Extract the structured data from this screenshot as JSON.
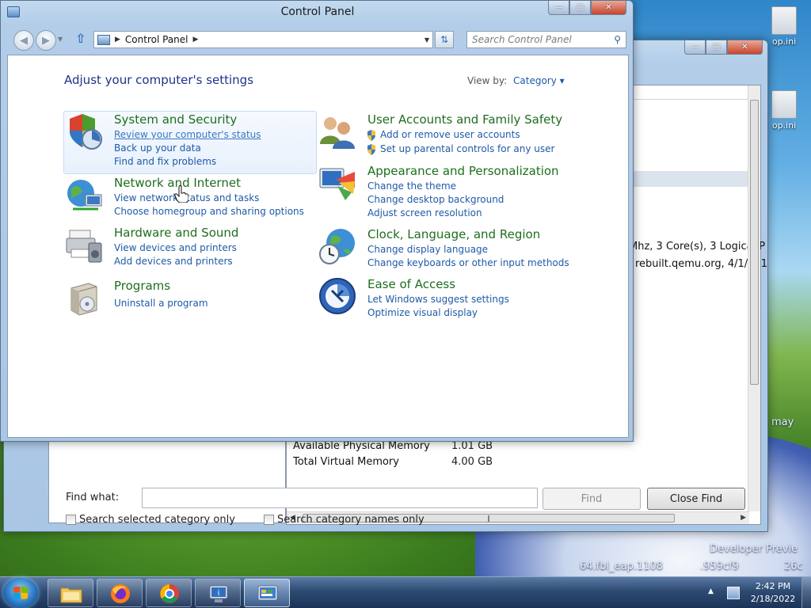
{
  "control_panel": {
    "title": "Control Panel",
    "breadcrumb": "Control Panel",
    "search_placeholder": "Search Control Panel",
    "heading": "Adjust your computer's settings",
    "view_by_label": "View by:",
    "view_by_value": "Category",
    "categories": [
      {
        "title": "System and Security",
        "links": [
          "Review your computer's status",
          "Back up your data",
          "Find and fix problems"
        ]
      },
      {
        "title": "Network and Internet",
        "links": [
          "View network status and tasks",
          "Choose homegroup and sharing options"
        ]
      },
      {
        "title": "Hardware and Sound",
        "links": [
          "View devices and printers",
          "Add devices and printers"
        ]
      },
      {
        "title": "Programs",
        "links": [
          "Uninstall a program"
        ]
      },
      {
        "title": "User Accounts and Family Safety",
        "links": [
          "Add or remove user accounts",
          "Set up parental controls for any user"
        ]
      },
      {
        "title": "Appearance and Personalization",
        "links": [
          "Change the theme",
          "Change desktop background",
          "Adjust screen resolution"
        ]
      },
      {
        "title": "Clock, Language, and Region",
        "links": [
          "Change display language",
          "Change keyboards or other input methods"
        ]
      },
      {
        "title": "Ease of Access",
        "links": [
          "Let Windows suggest settings",
          "Optimize visual display"
        ]
      }
    ]
  },
  "system_info": {
    "processor_fragment": "Mhz, 3 Core(s), 3 Logical P",
    "bios_fragment": "rebuilt.qemu.org, 4/1/201",
    "rows": [
      {
        "name": "Available Physical Memory",
        "value": "1.01 GB"
      },
      {
        "name": "Total Virtual Memory",
        "value": "4.00 GB"
      }
    ],
    "find_what_label": "Find what:",
    "find_value": "",
    "find_button": "Find",
    "close_find_button": "Close Find",
    "check_selected": "Search selected category only",
    "check_names": "Search category names only"
  },
  "desktop": {
    "icons": [
      "op.ini",
      "op.ini"
    ],
    "text_lines": [
      "Developer Previe",
      "64.fbl_eap.1108",
      ".959cf9",
      "26c",
      "may"
    ]
  },
  "taskbar": {
    "time": "2:42 PM",
    "date": "2/18/2022",
    "pinned": [
      "Windows Explorer",
      "Firefox",
      "Chrome",
      "System Information",
      "Control Panel"
    ]
  }
}
